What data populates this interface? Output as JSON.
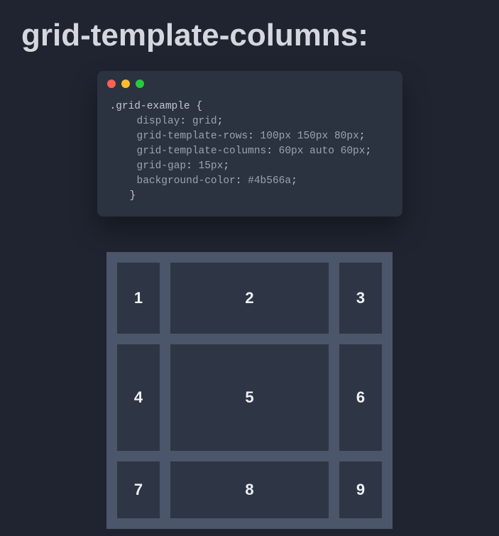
{
  "title": "grid-template-columns:",
  "code": {
    "selector": ".grid-example",
    "brace_open": "{",
    "brace_close": "}",
    "lines": [
      {
        "prop": "display",
        "val": "grid"
      },
      {
        "prop": "grid-template-rows",
        "val": "100px 150px 80px"
      },
      {
        "prop": "grid-template-columns",
        "val": "60px auto 60px"
      },
      {
        "prop": "grid-gap",
        "val": "15px"
      },
      {
        "prop": "background-color",
        "val": "#4b566a"
      }
    ]
  },
  "grid": {
    "cells": [
      "1",
      "2",
      "3",
      "4",
      "5",
      "6",
      "7",
      "8",
      "9"
    ]
  },
  "colors": {
    "page_bg": "#1f2430",
    "code_bg": "#2b3240",
    "grid_bg": "#4b566a",
    "cell_bg": "#2e3544",
    "dot_red": "#ff5f56",
    "dot_yellow": "#ffbd2e",
    "dot_green": "#27c93f"
  }
}
